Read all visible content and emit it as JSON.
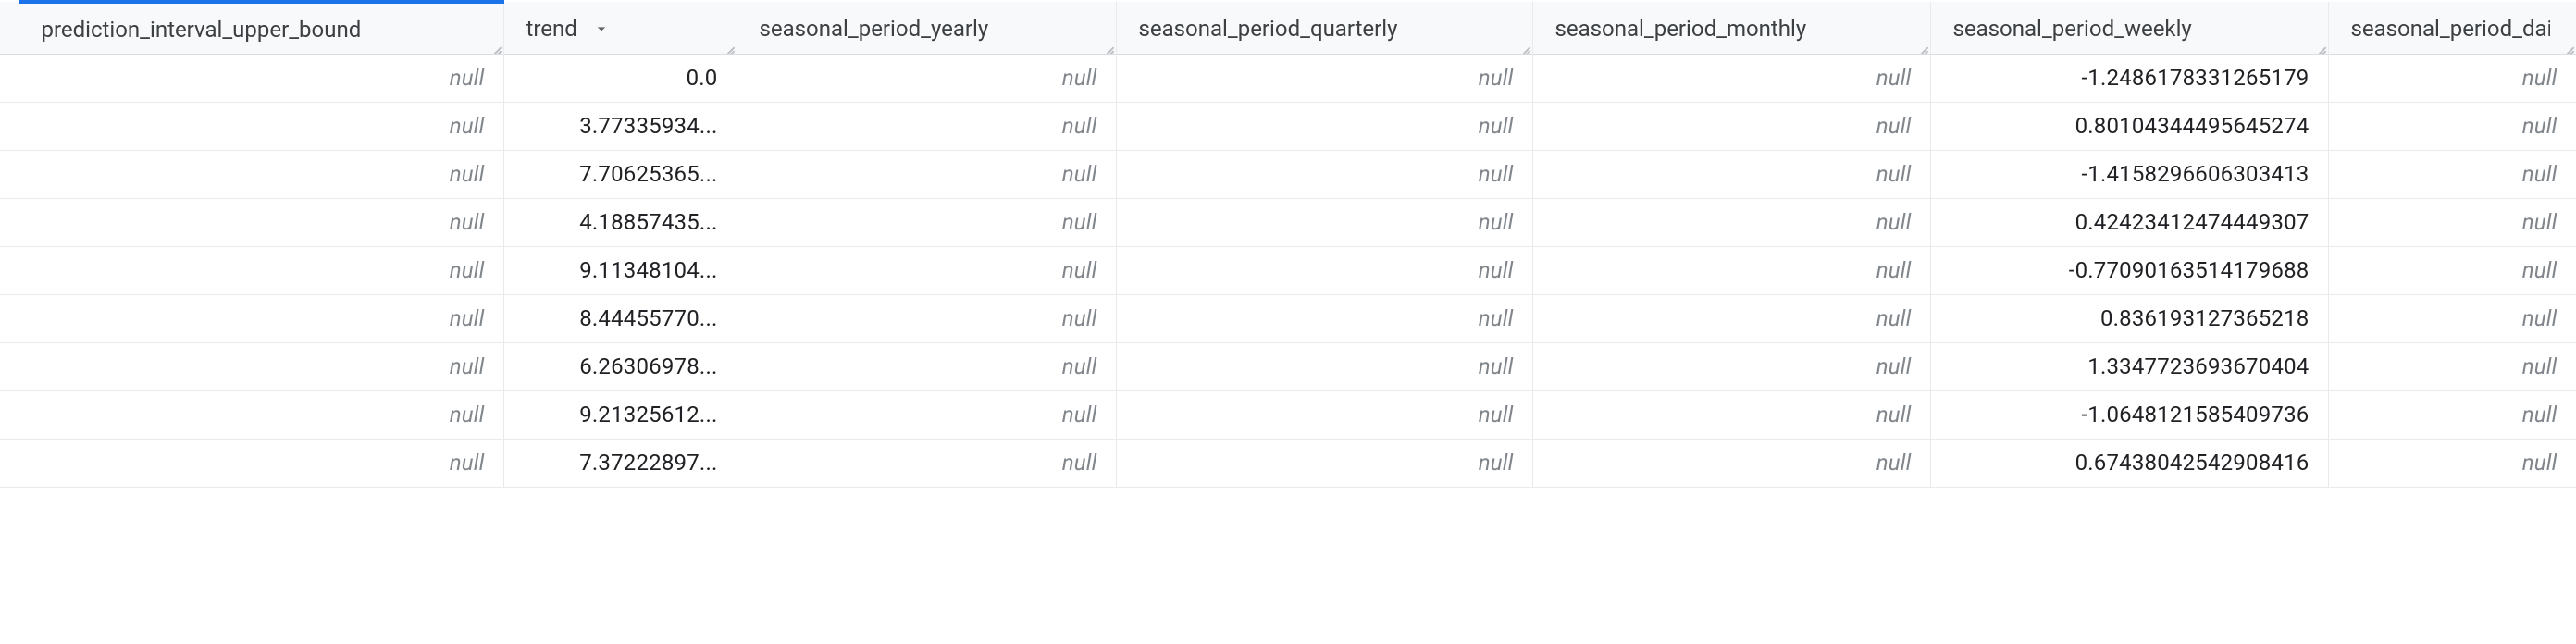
{
  "null_label": "null",
  "columns": [
    {
      "id": "prediction_interval_upper_bound",
      "label": "prediction_interval_upper_bound",
      "sorted": false,
      "active_tab": true
    },
    {
      "id": "trend",
      "label": "trend",
      "sorted": true,
      "sort_dir": "desc",
      "active_tab": false
    },
    {
      "id": "seasonal_period_yearly",
      "label": "seasonal_period_yearly",
      "sorted": false,
      "active_tab": false
    },
    {
      "id": "seasonal_period_quarterly",
      "label": "seasonal_period_quarterly",
      "sorted": false,
      "active_tab": false
    },
    {
      "id": "seasonal_period_monthly",
      "label": "seasonal_period_monthly",
      "sorted": false,
      "active_tab": false
    },
    {
      "id": "seasonal_period_weekly",
      "label": "seasonal_period_weekly",
      "sorted": false,
      "active_tab": false
    },
    {
      "id": "seasonal_period_daily",
      "label": "seasonal_period_daily",
      "sorted": false,
      "active_tab": false
    }
  ],
  "rows": [
    {
      "prediction_interval_upper_bound": null,
      "trend": "0.0",
      "seasonal_period_yearly": null,
      "seasonal_period_quarterly": null,
      "seasonal_period_monthly": null,
      "seasonal_period_weekly": "-1.2486178331265179",
      "seasonal_period_daily": null
    },
    {
      "prediction_interval_upper_bound": null,
      "trend": "3.77335934...",
      "seasonal_period_yearly": null,
      "seasonal_period_quarterly": null,
      "seasonal_period_monthly": null,
      "seasonal_period_weekly": "0.80104344495645274",
      "seasonal_period_daily": null
    },
    {
      "prediction_interval_upper_bound": null,
      "trend": "7.70625365...",
      "seasonal_period_yearly": null,
      "seasonal_period_quarterly": null,
      "seasonal_period_monthly": null,
      "seasonal_period_weekly": "-1.4158296606303413",
      "seasonal_period_daily": null
    },
    {
      "prediction_interval_upper_bound": null,
      "trend": "4.18857435...",
      "seasonal_period_yearly": null,
      "seasonal_period_quarterly": null,
      "seasonal_period_monthly": null,
      "seasonal_period_weekly": "0.42423412474449307",
      "seasonal_period_daily": null
    },
    {
      "prediction_interval_upper_bound": null,
      "trend": "9.11348104...",
      "seasonal_period_yearly": null,
      "seasonal_period_quarterly": null,
      "seasonal_period_monthly": null,
      "seasonal_period_weekly": "-0.77090163514179688",
      "seasonal_period_daily": null
    },
    {
      "prediction_interval_upper_bound": null,
      "trend": "8.44455770...",
      "seasonal_period_yearly": null,
      "seasonal_period_quarterly": null,
      "seasonal_period_monthly": null,
      "seasonal_period_weekly": "0.836193127365218",
      "seasonal_period_daily": null
    },
    {
      "prediction_interval_upper_bound": null,
      "trend": "6.26306978...",
      "seasonal_period_yearly": null,
      "seasonal_period_quarterly": null,
      "seasonal_period_monthly": null,
      "seasonal_period_weekly": "1.3347723693670404",
      "seasonal_period_daily": null
    },
    {
      "prediction_interval_upper_bound": null,
      "trend": "9.21325612...",
      "seasonal_period_yearly": null,
      "seasonal_period_quarterly": null,
      "seasonal_period_monthly": null,
      "seasonal_period_weekly": "-1.0648121585409736",
      "seasonal_period_daily": null
    },
    {
      "prediction_interval_upper_bound": null,
      "trend": "7.37222897...",
      "seasonal_period_yearly": null,
      "seasonal_period_quarterly": null,
      "seasonal_period_monthly": null,
      "seasonal_period_weekly": "0.67438042542908416",
      "seasonal_period_daily": null
    }
  ]
}
